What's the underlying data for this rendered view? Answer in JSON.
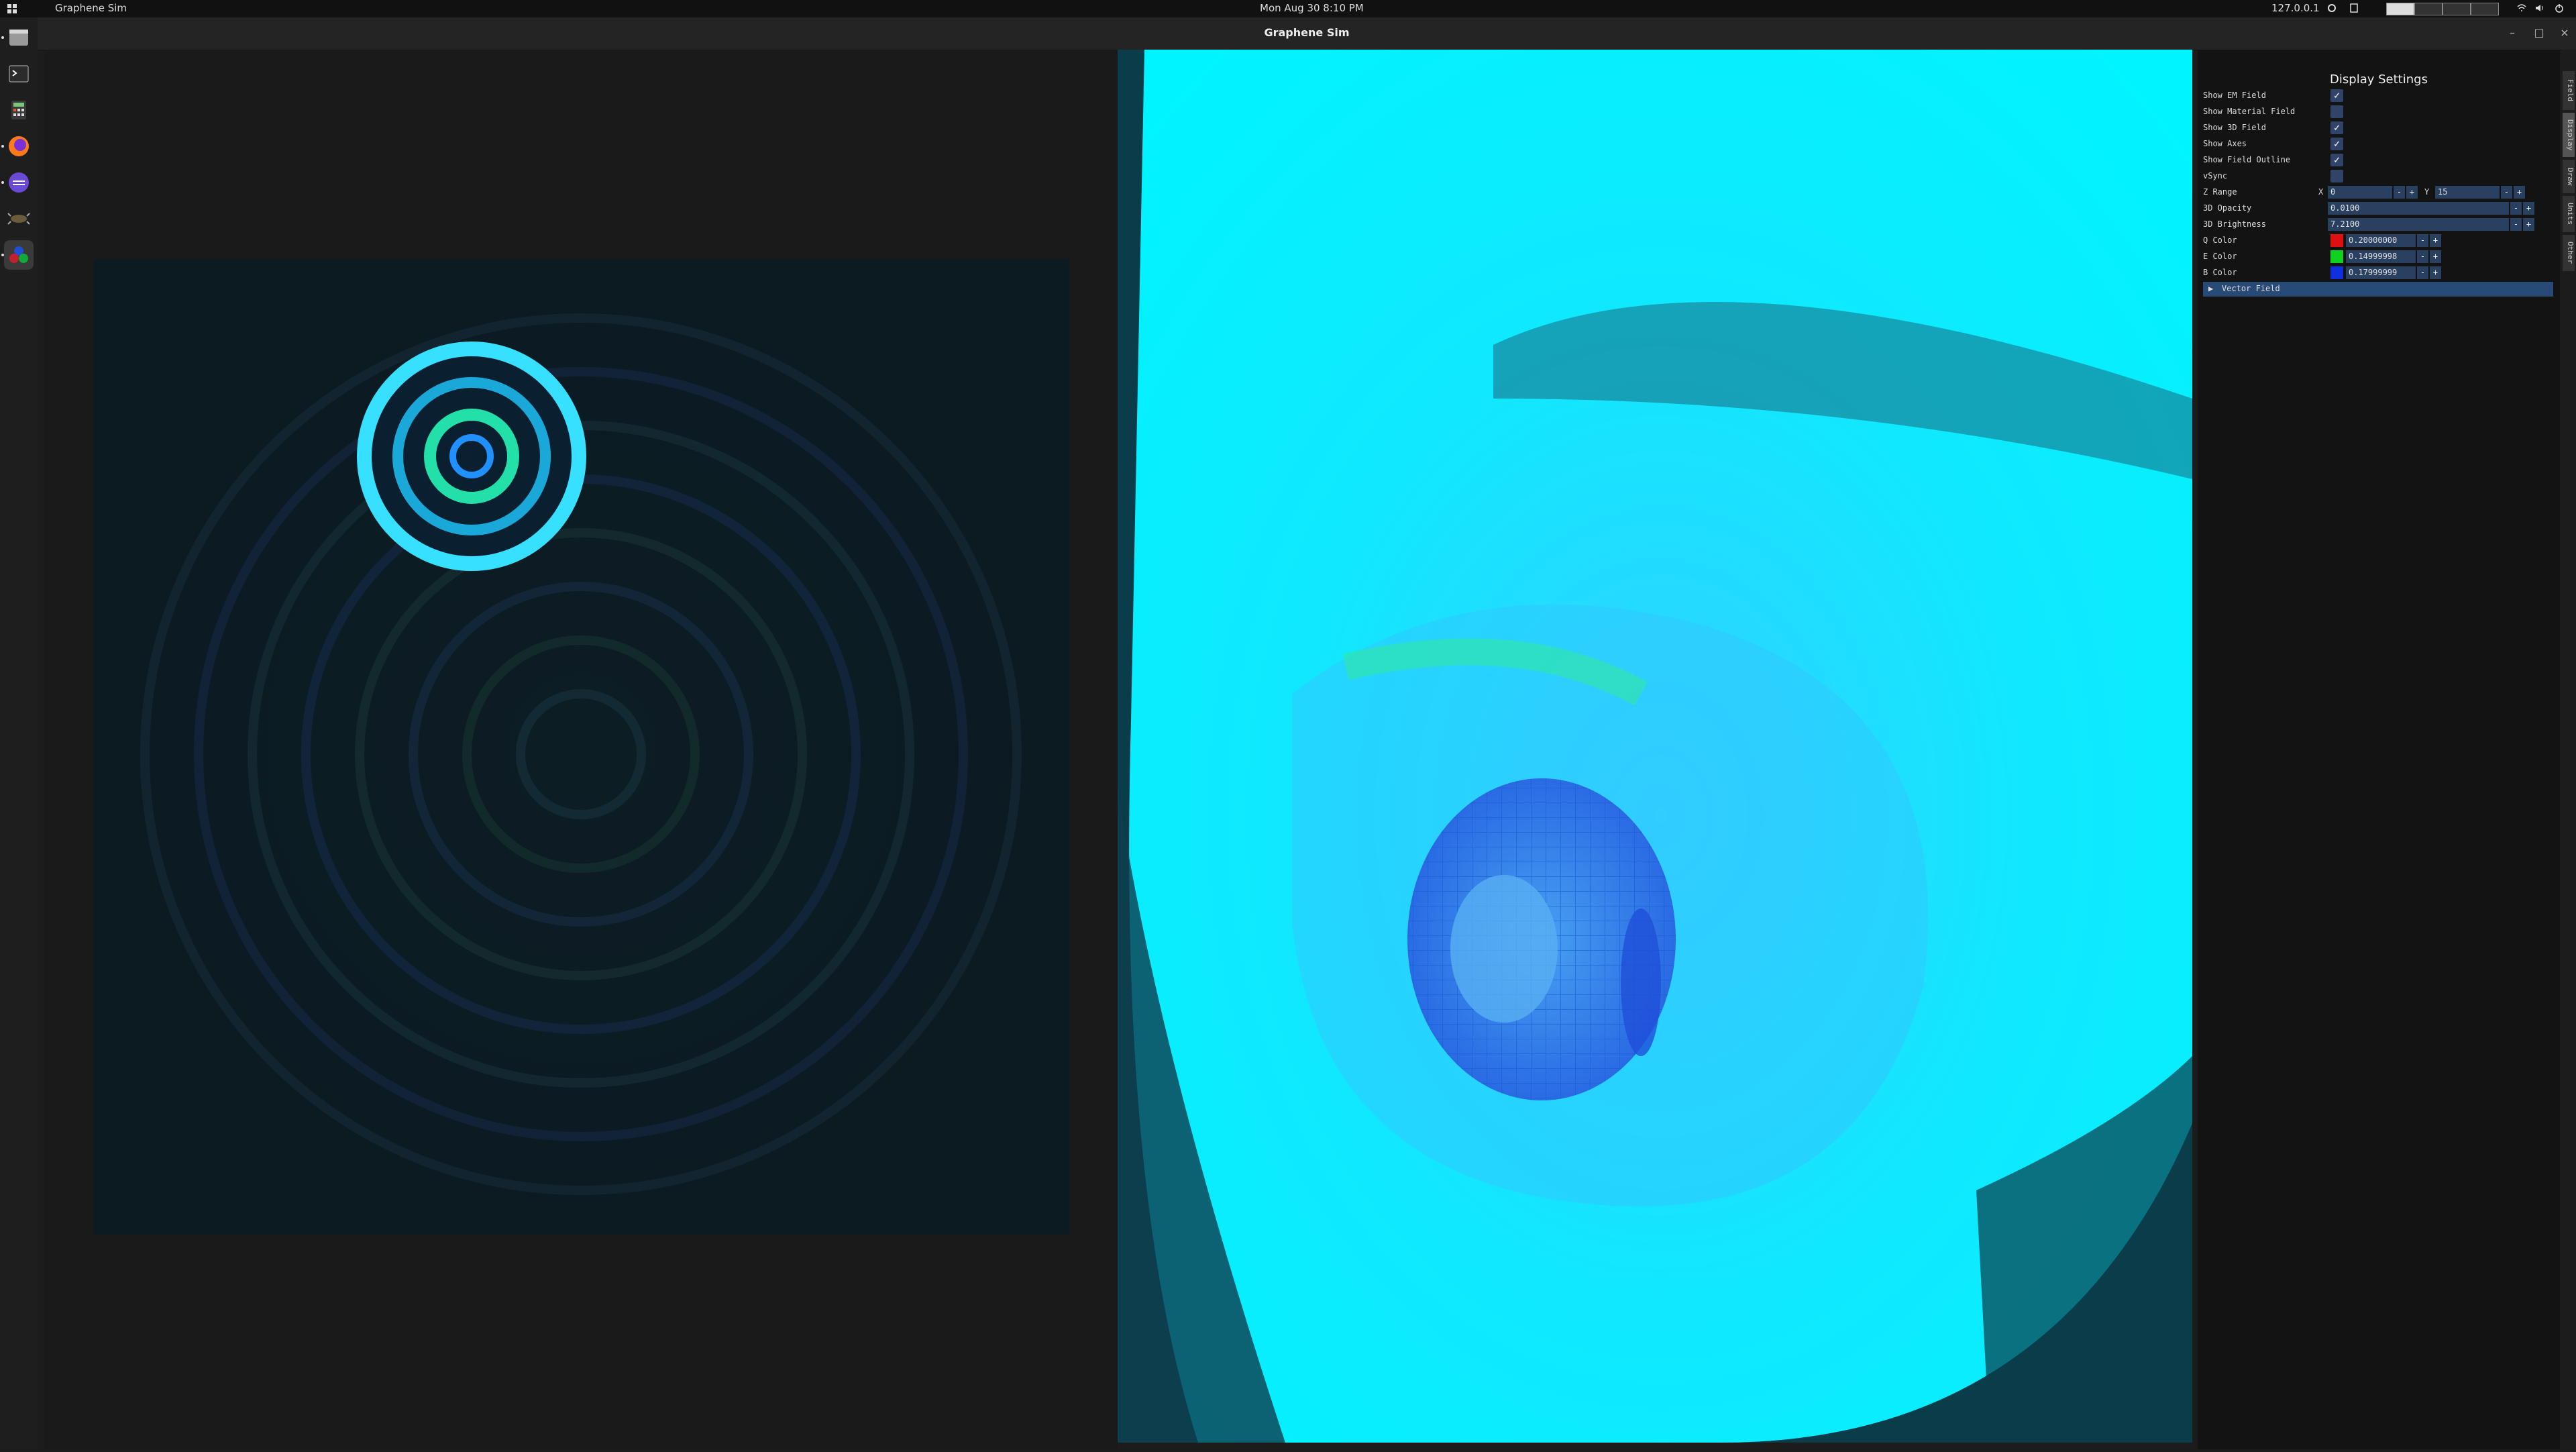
{
  "topbar": {
    "app_name": "Graphene Sim",
    "clock": "Mon Aug 30   8:10 PM",
    "ip": "127.0.0.1",
    "activities_icon": "grid-icon",
    "status_icons": [
      "sync-icon",
      "clipboard-icon",
      "network-icon",
      "volume-icon",
      "power-icon"
    ]
  },
  "dock": {
    "items": [
      "files-icon",
      "terminal-icon",
      "calculator-icon",
      "firefox-icon",
      "eclipse-icon",
      "bug-icon",
      "graphene-sim-icon"
    ]
  },
  "window": {
    "title": "Graphene Sim",
    "controls": [
      "minimize-icon",
      "maximize-icon",
      "close-icon"
    ]
  },
  "panel": {
    "title": "Display Settings",
    "checkboxes": [
      {
        "label": "Show EM Field",
        "checked": true
      },
      {
        "label": "Show Material Field",
        "checked": false
      },
      {
        "label": "Show 3D Field",
        "checked": true
      },
      {
        "label": "Show Axes",
        "checked": true
      },
      {
        "label": "Show Field Outline",
        "checked": true
      },
      {
        "label": "vSync",
        "checked": false
      }
    ],
    "z_range": {
      "label": "Z Range",
      "x_label": "X",
      "x_value": "0",
      "y_label": "Y",
      "y_value": "15"
    },
    "opacity": {
      "label": "3D Opacity",
      "value": "0.0100"
    },
    "brightness": {
      "label": "3D Brightness",
      "value": "7.2100"
    },
    "colors": [
      {
        "label": "Q Color",
        "value": "0.20000000",
        "swatch": "#e01010"
      },
      {
        "label": "E Color",
        "value": "0.14999998",
        "swatch": "#10d020"
      },
      {
        "label": "B Color",
        "value": "0.17999999",
        "swatch": "#1030e0"
      }
    ],
    "minus": "-",
    "plus": "+",
    "vector_field": "Vector Field",
    "vector_field_arrow": "▶"
  },
  "vtabs": [
    "Field",
    "Display",
    "Draw",
    "Units",
    "Other"
  ],
  "colors": {
    "accent": "#294061",
    "highlight": "#284a77",
    "field_cyan": "#00f0ff"
  }
}
